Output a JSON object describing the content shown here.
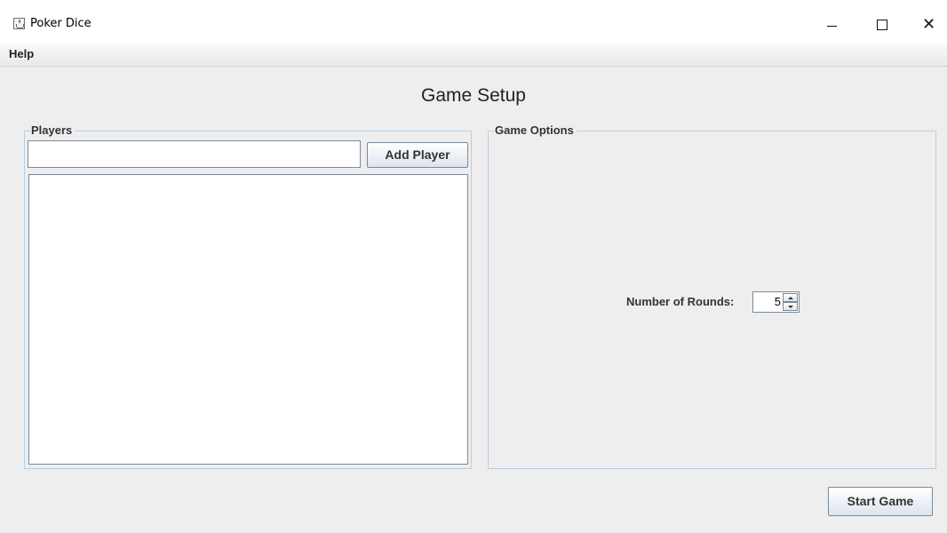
{
  "window": {
    "title": "Poker Dice",
    "icon": "java-cup-icon",
    "controls": {
      "minimize": "–",
      "maximize": "□",
      "close": "✕"
    }
  },
  "menubar": {
    "items": [
      {
        "label": "Help"
      }
    ]
  },
  "main": {
    "title": "Game Setup",
    "players": {
      "legend": "Players",
      "name_input_value": "",
      "add_button_label": "Add Player",
      "list_items": []
    },
    "options": {
      "legend": "Game Options",
      "rounds_label": "Number of Rounds:",
      "rounds_value": "5"
    },
    "start_button_label": "Start Game"
  },
  "colors": {
    "background": "#eeeeee",
    "group_border": "#b8cfe5",
    "control_border": "#7a8a99"
  }
}
